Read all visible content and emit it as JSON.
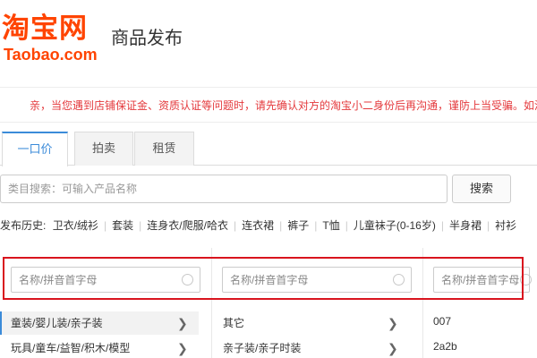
{
  "header": {
    "logo_cn": "淘宝网",
    "logo_en": "Taobao.com",
    "title": "商品发布"
  },
  "notice": "亲，当您遇到店铺保证金、资质认证等问题时，请先确认对方的淘宝小二身份后再沟通，谨防上当受骗。如涉",
  "tabs": [
    {
      "label": "一口价",
      "active": true
    },
    {
      "label": "拍卖",
      "active": false
    },
    {
      "label": "租赁",
      "active": false
    }
  ],
  "category_search": {
    "placeholder": "类目搜索：可输入产品名称",
    "button": "搜索"
  },
  "history": {
    "label": "发布历史:",
    "items": [
      "卫衣/绒衫",
      "套装",
      "连身衣/爬服/哈衣",
      "连衣裙",
      "裤子",
      "T恤",
      "儿童袜子(0-16岁)",
      "半身裙",
      "衬衫"
    ]
  },
  "columns": [
    {
      "placeholder": "名称/拼音首字母",
      "items": [
        {
          "label": "童装/婴儿装/亲子装",
          "selected": true,
          "has_children": true
        },
        {
          "label": "玩具/童车/益智/积木/模型",
          "selected": false,
          "has_children": true
        }
      ]
    },
    {
      "placeholder": "名称/拼音首字母",
      "items": [
        {
          "label": "其它",
          "selected": false,
          "has_children": true
        },
        {
          "label": "亲子装/亲子时装",
          "selected": false,
          "has_children": true
        }
      ]
    },
    {
      "placeholder": "名称/拼音首字母",
      "items": [
        {
          "label": "007",
          "selected": false,
          "has_children": false
        },
        {
          "label": "2a2b",
          "selected": false,
          "has_children": false
        }
      ]
    }
  ],
  "chevron_glyph": "❯",
  "colors": {
    "brand": "#ff4400",
    "notice_text": "#e4393c",
    "tab_active": "#3b8bd9",
    "highlight_border": "#d9141e"
  }
}
